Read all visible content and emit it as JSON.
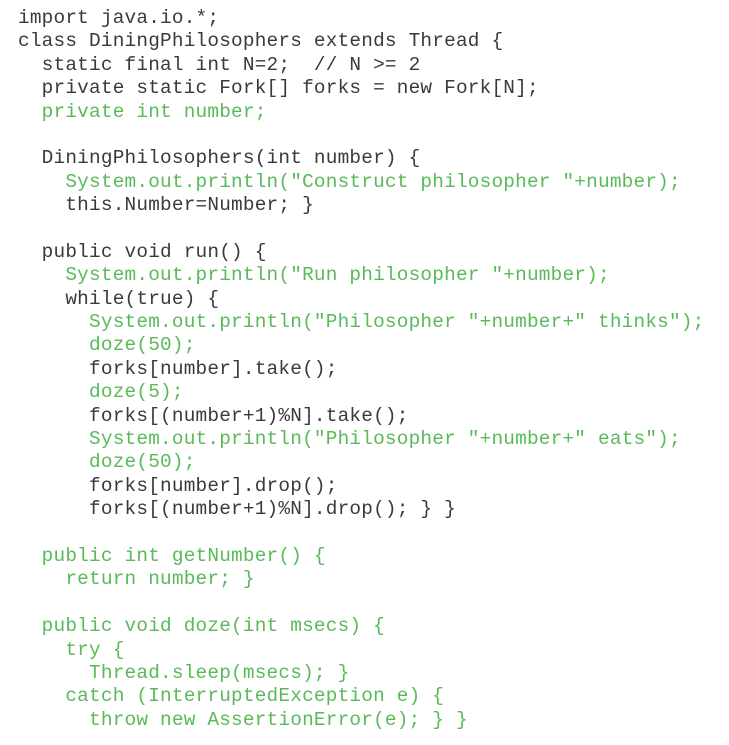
{
  "colors": {
    "dark": "#3a3a3a",
    "green": "#5aba5a",
    "background": "#ffffff"
  },
  "code_lines": [
    [
      {
        "t": "import java.io.*;",
        "c": "dark"
      }
    ],
    [
      {
        "t": "class DiningPhilosophers extends Thread {",
        "c": "dark"
      }
    ],
    [
      {
        "t": "  static final int N=2;  // N >= 2",
        "c": "dark"
      }
    ],
    [
      {
        "t": "  private static Fork[] forks = new Fork[N];",
        "c": "dark"
      }
    ],
    [
      {
        "t": "  private int number;",
        "c": "green"
      }
    ],
    [],
    [
      {
        "t": "  DiningPhilosophers(int number) {",
        "c": "dark"
      }
    ],
    [
      {
        "t": "    System.out.println(\"Construct philosopher \"+number);",
        "c": "green"
      }
    ],
    [
      {
        "t": "    this.Number=Number; }",
        "c": "dark"
      }
    ],
    [],
    [
      {
        "t": "  public void run() {",
        "c": "dark"
      }
    ],
    [
      {
        "t": "    System.out.println(\"Run philosopher \"+number);",
        "c": "green"
      }
    ],
    [
      {
        "t": "    while(true) {",
        "c": "dark"
      }
    ],
    [
      {
        "t": "      System.out.println(\"Philosopher \"+number+\" thinks\");",
        "c": "green"
      }
    ],
    [
      {
        "t": "      doze(50);",
        "c": "green"
      }
    ],
    [
      {
        "t": "      forks[number].take();",
        "c": "dark"
      }
    ],
    [
      {
        "t": "      doze(5);",
        "c": "green"
      }
    ],
    [
      {
        "t": "      forks[(number+1)%N].take();",
        "c": "dark"
      }
    ],
    [
      {
        "t": "      System.out.println(\"Philosopher \"+number+\" eats\");",
        "c": "green"
      }
    ],
    [
      {
        "t": "      doze(50);",
        "c": "green"
      }
    ],
    [
      {
        "t": "      forks[number].drop();",
        "c": "dark"
      }
    ],
    [
      {
        "t": "      forks[(number+1)%N].drop(); } }",
        "c": "dark"
      }
    ],
    [],
    [
      {
        "t": "  public int getNumber() {",
        "c": "green"
      }
    ],
    [
      {
        "t": "    return number; }",
        "c": "green"
      }
    ],
    [],
    [
      {
        "t": "  public void doze(int msecs) {",
        "c": "green"
      }
    ],
    [
      {
        "t": "    try {",
        "c": "green"
      }
    ],
    [
      {
        "t": "      Thread.sleep(msecs); }",
        "c": "green"
      }
    ],
    [
      {
        "t": "    catch (InterruptedException e) {",
        "c": "green"
      }
    ],
    [
      {
        "t": "      throw new AssertionError(e); } }",
        "c": "green"
      }
    ]
  ]
}
